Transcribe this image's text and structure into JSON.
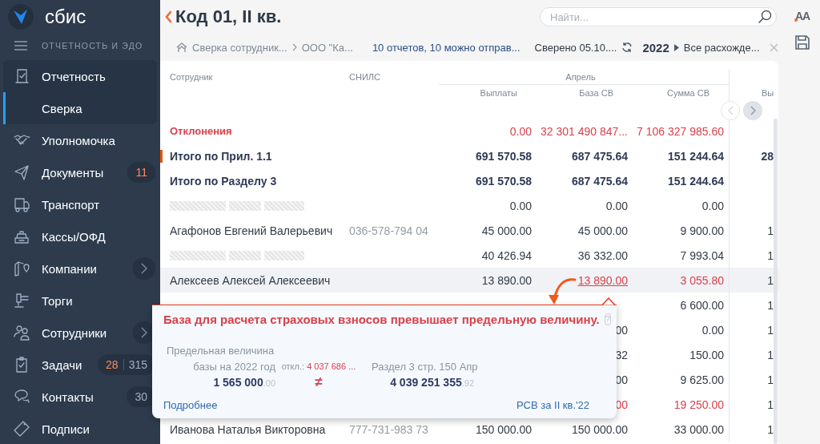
{
  "sidebar": {
    "brand": "сбис",
    "section": "ОТЧЕТНОСТЬ И ЭДО",
    "items": [
      {
        "label": "Отчетность",
        "expanded": true,
        "selected": false,
        "children": [
          {
            "label": "Сверка",
            "selected": true
          }
        ]
      },
      {
        "label": "Уполномочка",
        "selected": false
      },
      {
        "label": "Документы",
        "selected": false,
        "counters": [
          {
            "text": "11",
            "kind": "new"
          }
        ]
      },
      {
        "label": "Транспорт",
        "selected": false
      },
      {
        "label": "Кассы/ОФД",
        "selected": false
      },
      {
        "label": "Компании",
        "selected": false,
        "submenu": true
      },
      {
        "label": "Торги",
        "selected": false
      },
      {
        "label": "Сотрудники",
        "selected": false,
        "submenu": true
      },
      {
        "label": "Задачи",
        "selected": false,
        "counters": [
          {
            "text": "28",
            "kind": "new"
          },
          {
            "text": "315",
            "kind": "total"
          }
        ]
      },
      {
        "label": "Контакты",
        "selected": false,
        "counters": [
          {
            "text": "30",
            "kind": "total"
          }
        ]
      },
      {
        "label": "Подписи",
        "selected": false
      }
    ]
  },
  "header": {
    "title": "Код 01, II кв.",
    "search": {
      "placeholder": "Найти..."
    },
    "breadcrumbs": [
      "Сверка сотрудник...",
      "ООО \"Ка..."
    ],
    "reports_link": "10 отчетов, 10 можно отправ...",
    "reconciled": "Сверено 05.10....",
    "year": "2022",
    "filter": "Все расхожде..."
  },
  "toolbar": {
    "font_size": "AA"
  },
  "table": {
    "columns": [
      "Сотрудник",
      "СНИЛС"
    ],
    "group": "Апрель",
    "subcolumns": [
      "Выплаты",
      "База СВ",
      "Сумма СВ",
      "Вы"
    ],
    "rows": [
      {
        "kind": "deviation",
        "selected": false,
        "marked": false,
        "name": "Отклонения",
        "cells": [
          {
            "text": "0.00",
            "kind": "alert"
          },
          {
            "text": "32 301 490 847...",
            "kind": "alert"
          },
          {
            "text": "7 106 327 985.60",
            "kind": "alert"
          },
          {
            "text": "",
            "kind": "plain"
          }
        ]
      },
      {
        "kind": "total",
        "selected": false,
        "marked": true,
        "name": "Итого по Прил. 1.1",
        "cells": [
          {
            "text": "691 570.58",
            "kind": "plain"
          },
          {
            "text": "687 475.64",
            "kind": "plain"
          },
          {
            "text": "151 244.64",
            "kind": "plain"
          },
          {
            "text": "28",
            "kind": "plain"
          }
        ]
      },
      {
        "kind": "total",
        "selected": false,
        "marked": false,
        "name": "Итого по Разделу 3",
        "cells": [
          {
            "text": "691 570.58",
            "kind": "plain"
          },
          {
            "text": "687 475.64",
            "kind": "plain"
          },
          {
            "text": "151 244.64",
            "kind": "plain"
          },
          {
            "text": "",
            "kind": "plain"
          }
        ]
      },
      {
        "kind": "redacted",
        "selected": false,
        "marked": false,
        "cells": [
          {
            "text": "0.00",
            "kind": "plain"
          },
          {
            "text": "0.00",
            "kind": "plain"
          },
          {
            "text": "0.00",
            "kind": "plain"
          },
          {
            "text": "",
            "kind": "plain"
          }
        ]
      },
      {
        "kind": "person",
        "selected": false,
        "marked": false,
        "name": "Агафонов Евгений Валерьевич",
        "snils": "036-578-794 04",
        "cells": [
          {
            "text": "45 000.00",
            "kind": "plain"
          },
          {
            "text": "45 000.00",
            "kind": "plain"
          },
          {
            "text": "9 900.00",
            "kind": "plain"
          },
          {
            "text": "1",
            "kind": "plain"
          }
        ]
      },
      {
        "kind": "redacted",
        "selected": false,
        "marked": false,
        "cells": [
          {
            "text": "40 426.94",
            "kind": "plain"
          },
          {
            "text": "36 332.00",
            "kind": "plain"
          },
          {
            "text": "7 993.04",
            "kind": "plain"
          },
          {
            "text": "1",
            "kind": "plain"
          }
        ]
      },
      {
        "kind": "person",
        "selected": true,
        "marked": false,
        "name": "Алексеев Алексей Алексеевич",
        "cells": [
          {
            "text": "13 890.00",
            "kind": "plain"
          },
          {
            "text": "13 890.00",
            "kind": "alert-link"
          },
          {
            "text": "3 055.80",
            "kind": "alert"
          },
          {
            "text": "1",
            "kind": "plain"
          }
        ]
      },
      {
        "kind": "hidden",
        "selected": false,
        "cells": [
          {
            "text": "",
            "kind": "plain"
          },
          {
            "text": "",
            "kind": "plain"
          },
          {
            "text": "6 600.00",
            "kind": "plain"
          },
          {
            "text": "1",
            "kind": "plain"
          }
        ]
      },
      {
        "kind": "hidden",
        "selected": false,
        "cells": [
          {
            "text": "",
            "kind": "plain"
          },
          {
            "text": "00",
            "kind": "plain"
          },
          {
            "text": "0.00",
            "kind": "plain"
          },
          {
            "text": "1",
            "kind": "plain"
          }
        ]
      },
      {
        "kind": "hidden",
        "selected": false,
        "cells": [
          {
            "text": "",
            "kind": "plain"
          },
          {
            "text": "32",
            "kind": "plain"
          },
          {
            "text": "150.00",
            "kind": "plain"
          },
          {
            "text": "1",
            "kind": "plain"
          }
        ]
      },
      {
        "kind": "hidden",
        "selected": false,
        "cells": [
          {
            "text": "",
            "kind": "plain"
          },
          {
            "text": "00",
            "kind": "plain"
          },
          {
            "text": "9 625.00",
            "kind": "plain"
          },
          {
            "text": "1",
            "kind": "plain"
          }
        ]
      },
      {
        "kind": "hidden",
        "selected": false,
        "cells": [
          {
            "text": "",
            "kind": "plain"
          },
          {
            "text": "00",
            "kind": "alert"
          },
          {
            "text": "19 250.00",
            "kind": "alert"
          },
          {
            "text": "1",
            "kind": "plain"
          }
        ]
      },
      {
        "kind": "person",
        "selected": false,
        "marked": false,
        "name": "Иванова Наталья Викторовна",
        "snils": "777-731-983 73",
        "cells": [
          {
            "text": "150 000.00",
            "kind": "plain"
          },
          {
            "text": "150 000.00",
            "kind": "plain"
          },
          {
            "text": "33 000.00",
            "kind": "plain"
          },
          {
            "text": "1",
            "kind": "plain"
          }
        ]
      }
    ]
  },
  "popup": {
    "title": "База для расчета страховых взносов превышает предельную величину.",
    "help": "?",
    "limit_label": "Предельная величина",
    "limit_sublabel": "базы на 2022 год",
    "limit_value": {
      "integer": "1 565 000",
      "fraction": ".00"
    },
    "deviation_label": "откл.:",
    "deviation_value": "4 037 686 ...",
    "sign": "≠",
    "source_label": "Раздел 3 стр. 150 Апр",
    "source_value": {
      "integer": "4 039 251 355",
      "fraction": ".92"
    },
    "more_link": "Подробнее",
    "report_link": "РСВ за II кв.'22"
  }
}
